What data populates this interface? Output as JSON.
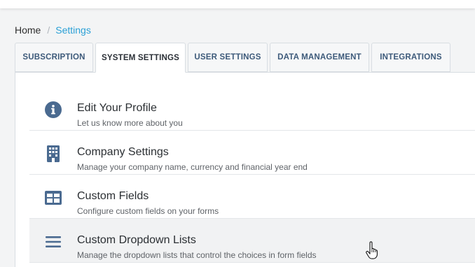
{
  "breadcrumb": {
    "home": "Home",
    "separator": "/",
    "current": "Settings"
  },
  "tabs": [
    {
      "label": "SUBSCRIPTION",
      "active": false
    },
    {
      "label": "SYSTEM SETTINGS",
      "active": true
    },
    {
      "label": "USER SETTINGS",
      "active": false
    },
    {
      "label": "DATA MANAGEMENT",
      "active": false
    },
    {
      "label": "INTEGRATIONS",
      "active": false
    }
  ],
  "items": [
    {
      "title": "Edit Your Profile",
      "description": "Let us know more about you",
      "icon": "info-circle-icon"
    },
    {
      "title": "Company Settings",
      "description": "Manage your company name, currency and financial year end",
      "icon": "building-icon"
    },
    {
      "title": "Custom Fields",
      "description": "Configure custom fields on your forms",
      "icon": "table-icon"
    },
    {
      "title": "Custom Dropdown Lists",
      "description": "Manage the dropdown lists that control the choices in form fields",
      "icon": "list-icon"
    }
  ],
  "colors": {
    "accent": "#2aa0d6",
    "icon": "#4a6a90",
    "tab_text": "#3d5a7a",
    "hover_row": "#f1f2f3"
  }
}
